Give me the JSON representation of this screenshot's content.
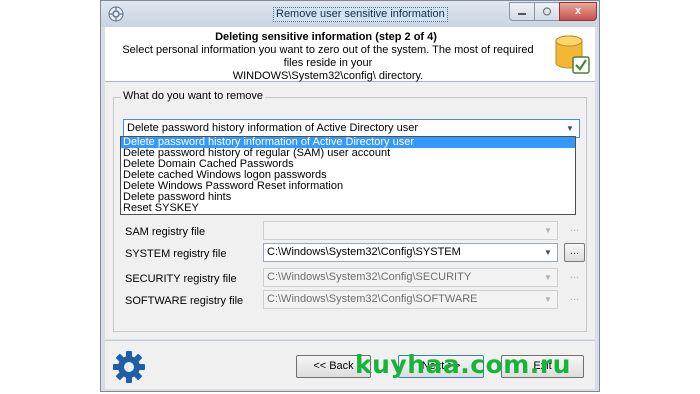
{
  "window": {
    "title": "Remove user sensitive information",
    "app_icon": "app-icon",
    "minimize_icon": "minimize-icon",
    "maximize_icon": "maximize-icon",
    "close_icon": "close-icon",
    "close_label": "x"
  },
  "header": {
    "title": "Deleting sensitive information (step 2 of 4)",
    "description_line1": "Select personal information you want to zero out of the system. The most of required files reside in your",
    "description_line2": "WINDOWS\\System32\\config\\ directory.",
    "icon": "database-check-icon"
  },
  "group": {
    "label": "What do you want to remove",
    "selected_option": "Delete password history information of Active Directory user",
    "options": [
      "Delete password history information of Active Directory user",
      "Delete password history of regular (SAM) user account",
      "Delete Domain Cached Passwords",
      "Delete cached Windows logon passwords",
      "Delete Windows Password Reset information",
      "Delete password hints",
      "Reset SYSKEY"
    ]
  },
  "fields": {
    "sam": {
      "label": "SAM registry file",
      "value": ""
    },
    "system": {
      "label": "SYSTEM registry file",
      "value": "C:\\Windows\\System32\\Config\\SYSTEM"
    },
    "security": {
      "label": "SECURITY registry file",
      "value": "C:\\Windows\\System32\\Config\\SECURITY"
    },
    "software": {
      "label": "SOFTWARE registry file",
      "value": "C:\\Windows\\System32\\Config\\SOFTWARE"
    },
    "browse_label": "...",
    "dropdown_arrow": "▼"
  },
  "footer": {
    "back_label": "<< Back",
    "next_label": "Next >>",
    "exit_label": "Exit",
    "gear_icon": "gear-icon"
  },
  "watermark": "kuyhaa.com.ru",
  "colors": {
    "selection": "#3399ff",
    "watermark": "#16b43a",
    "gear": "#1f5fa8"
  }
}
